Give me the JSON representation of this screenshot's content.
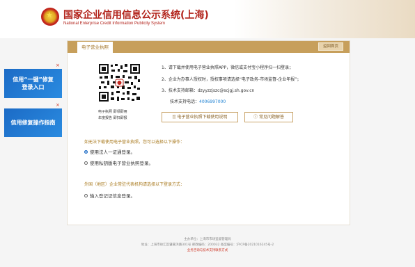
{
  "header": {
    "title": "国家企业信用信息公示系统(上海)",
    "subtitle": "National Enterprise Credit Information Publicity System"
  },
  "side_banners": [
    {
      "label_line1": "信用“一键”修复",
      "label_line2": "登录入口",
      "close": "×"
    },
    {
      "label_line1": "信用修复操作指南",
      "close": "×"
    }
  ],
  "card": {
    "tab": "电子营业执照",
    "back_button": "返回首页",
    "qr_caption_line1": "电子执照 即领即用",
    "qr_caption_line2": "年度报告 即扫即报",
    "steps": [
      "1、请下载并使用电子营业执照APP，微信或支付宝小程序扫一扫登录；",
      "2、企业为办事人授权时，授权事项请选择“电子政务-市场监督-企业年报”；",
      "3、技术支持邮箱：dzyyzzjszc@scjgj.sh.gov.cn"
    ],
    "phone_label": "技术支持电话：",
    "phone_value": "4006997000",
    "download_button": "电子营业执照下载使用说明",
    "faq_button": "常见问题解答",
    "section1_title": "如无法下载使用电子营业执照，您可以选择以下操作：",
    "option1": "使用法人一证通登录。",
    "option2": "使用私钥版电子营业执照登录。",
    "section2_title": "外国（地区）企业常驻代表机构请选择以下登录方式：",
    "option3": "输入登记证信息登录。"
  },
  "footer": {
    "line1": "主办单位：上海市市场监督管理局",
    "line2": "地址：上海市徐汇区肇嘉浜路301号 邮政编码：200032 备案编号：沪ICP备2021016245号-2",
    "line3": "业务咨询与技术支持联系方式"
  },
  "colors": {
    "brand_red": "#b2231b",
    "gold": "#c79f5b",
    "banner_blue": "#1c6bc6"
  }
}
